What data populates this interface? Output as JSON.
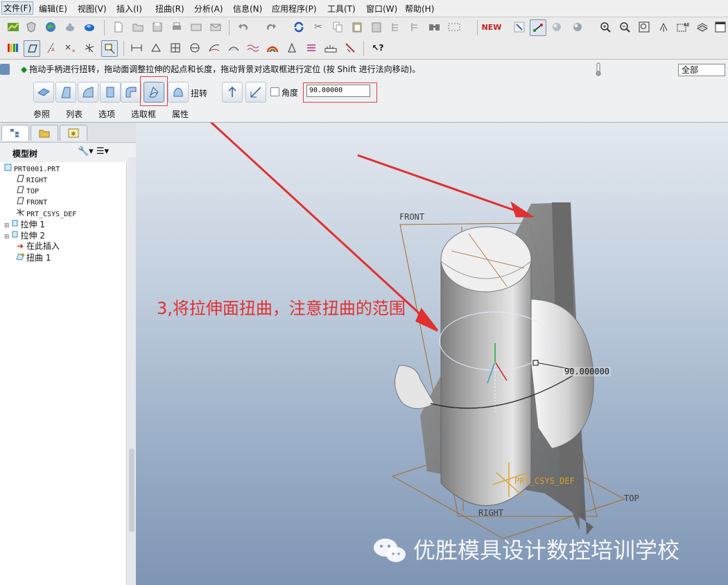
{
  "menubar": {
    "items": [
      "文件(F)",
      "编辑(E)",
      "视图(V)",
      "插入(I)",
      "扭曲(R)",
      "分析(A)",
      "信息(N)",
      "应用程序(P)",
      "工具(T)",
      "窗口(W)",
      "帮助(H)"
    ]
  },
  "toolbar": {
    "new_label": "NEW",
    "icons_row1": [
      "analysis-icon",
      "shield-icon",
      "globe-icon",
      "teapot-icon",
      "shaded-icon",
      "new-file-icon",
      "open-icon",
      "save-icon",
      "print-icon",
      "mail-icon",
      "send-icon",
      "undo-icon",
      "redo-icon",
      "regenerate-icon",
      "cut-icon",
      "copy-icon",
      "paste-icon",
      "paste-special-icon",
      "feature-icon",
      "feature-tree-icon",
      "find-icon",
      "select-box-icon",
      "layer-new-icon",
      "datum-point-icon",
      "spin-center-icon",
      "sphere-icon",
      "zoom-in-icon",
      "zoom-out-icon",
      "refit-icon",
      "orient-icon",
      "named-view-icon",
      "layers-icon",
      "window-icon"
    ],
    "icons_row2": [
      "color-bars-icon",
      "plane-display-icon",
      "axis-display-icon",
      "point-display-icon",
      "csys-display-icon",
      "annotation-display-icon",
      "measure-icon",
      "area-icon",
      "grid-icon",
      "section-icon",
      "curve-icon",
      "surface-icon",
      "wave-icon",
      "rainbow-icon",
      "draft-icon",
      "stack-icon",
      "ruler-icon",
      "brush-icon",
      "help-query-icon"
    ]
  },
  "dashboard": {
    "message": "拖动手柄进行扭转，拖动面调整拉伸的起点和长度，拖动背景对选取框进行定位 (按 Shift 进行法向移动)。",
    "filter_value": "全部",
    "twist_label": "扭转",
    "angle_label": "角度",
    "angle_value": "90.00000",
    "tabs": [
      "参照",
      "列表",
      "选项",
      "选取框",
      "属性"
    ]
  },
  "model_tree": {
    "title": "模型树",
    "items": [
      {
        "label": "PRT0001.PRT",
        "icon": "part-icon"
      },
      {
        "label": "RIGHT",
        "icon": "datum-plane-icon"
      },
      {
        "label": "TOP",
        "icon": "datum-plane-icon"
      },
      {
        "label": "FRONT",
        "icon": "datum-plane-icon"
      },
      {
        "label": "PRT_CSYS_DEF",
        "icon": "csys-icon"
      },
      {
        "label": "拉伸 1",
        "icon": "extrude-icon"
      },
      {
        "label": "拉伸 2",
        "icon": "extrude-icon"
      },
      {
        "label": "在此插入",
        "icon": "insert-here-icon"
      },
      {
        "label": "扭曲 1",
        "icon": "warp-icon"
      }
    ]
  },
  "viewport": {
    "datum_labels": {
      "front": "FRONT",
      "top": "TOP",
      "right": "RIGHT"
    },
    "angle_display": "90.000000",
    "csys_label": "PRT_CSYS_DEF",
    "annotation": "3,将拉伸面扭曲，注意扭曲的范围",
    "watermark": "优胜模具设计数控培训学校"
  },
  "colors": {
    "accent_red": "#e03030",
    "highlight_orange": "#c97b2a"
  }
}
